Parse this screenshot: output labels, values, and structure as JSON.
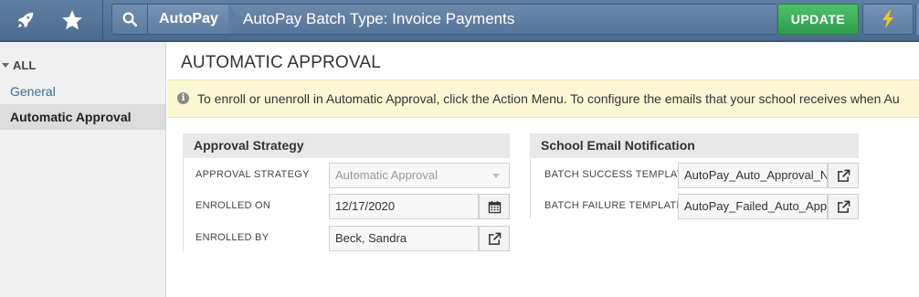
{
  "topbar": {
    "icons": [
      "rocket-icon",
      "star-icon",
      "search-icon",
      "lightning-icon"
    ],
    "module": "AutoPay",
    "title": "AutoPay Batch Type: Invoice Payments",
    "update_label": "UPDATE",
    "update_color": "#38a957",
    "bar_color": "#587aa0"
  },
  "sidebar": {
    "all_label": "ALL",
    "items": [
      {
        "label": "General"
      },
      {
        "label": "Automatic Approval"
      }
    ]
  },
  "main": {
    "title": "AUTOMATIC APPROVAL",
    "info_text": "To enroll or unenroll in Automatic Approval, click the Action Menu. To configure the emails that your school receives when Au",
    "approval": {
      "heading": "Approval Strategy",
      "strategy_label": "APPROVAL STRATEGY",
      "strategy_value": "Automatic Approval",
      "enrolled_on_label": "ENROLLED ON",
      "enrolled_on_value": "12/17/2020",
      "enrolled_by_label": "ENROLLED BY",
      "enrolled_by_value": "Beck, Sandra"
    },
    "email": {
      "heading": "School Email Notification",
      "success_label": "BATCH SUCCESS TEMPLATE",
      "success_value": "AutoPay_Auto_Approval_N",
      "failure_label": "BATCH FAILURE TEMPLATE",
      "failure_value": "AutoPay_Failed_Auto_Appr"
    }
  }
}
